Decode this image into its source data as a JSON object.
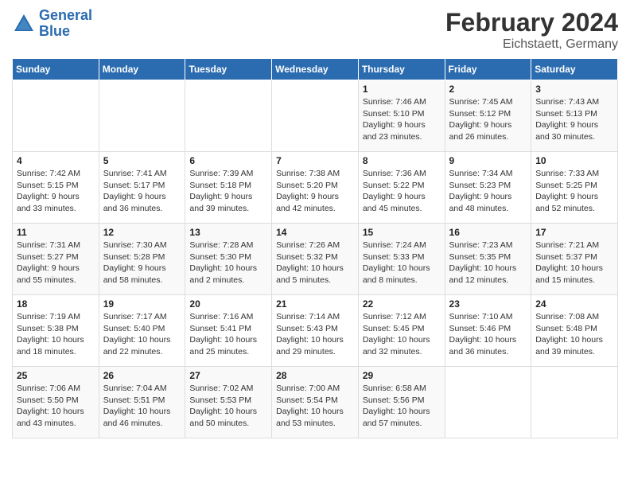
{
  "header": {
    "logo_general": "General",
    "logo_blue": "Blue",
    "month_title": "February 2024",
    "subtitle": "Eichstaett, Germany"
  },
  "days_of_week": [
    "Sunday",
    "Monday",
    "Tuesday",
    "Wednesday",
    "Thursday",
    "Friday",
    "Saturday"
  ],
  "weeks": [
    [
      {
        "day": "",
        "info": ""
      },
      {
        "day": "",
        "info": ""
      },
      {
        "day": "",
        "info": ""
      },
      {
        "day": "",
        "info": ""
      },
      {
        "day": "1",
        "info": "Sunrise: 7:46 AM\nSunset: 5:10 PM\nDaylight: 9 hours\nand 23 minutes."
      },
      {
        "day": "2",
        "info": "Sunrise: 7:45 AM\nSunset: 5:12 PM\nDaylight: 9 hours\nand 26 minutes."
      },
      {
        "day": "3",
        "info": "Sunrise: 7:43 AM\nSunset: 5:13 PM\nDaylight: 9 hours\nand 30 minutes."
      }
    ],
    [
      {
        "day": "4",
        "info": "Sunrise: 7:42 AM\nSunset: 5:15 PM\nDaylight: 9 hours\nand 33 minutes."
      },
      {
        "day": "5",
        "info": "Sunrise: 7:41 AM\nSunset: 5:17 PM\nDaylight: 9 hours\nand 36 minutes."
      },
      {
        "day": "6",
        "info": "Sunrise: 7:39 AM\nSunset: 5:18 PM\nDaylight: 9 hours\nand 39 minutes."
      },
      {
        "day": "7",
        "info": "Sunrise: 7:38 AM\nSunset: 5:20 PM\nDaylight: 9 hours\nand 42 minutes."
      },
      {
        "day": "8",
        "info": "Sunrise: 7:36 AM\nSunset: 5:22 PM\nDaylight: 9 hours\nand 45 minutes."
      },
      {
        "day": "9",
        "info": "Sunrise: 7:34 AM\nSunset: 5:23 PM\nDaylight: 9 hours\nand 48 minutes."
      },
      {
        "day": "10",
        "info": "Sunrise: 7:33 AM\nSunset: 5:25 PM\nDaylight: 9 hours\nand 52 minutes."
      }
    ],
    [
      {
        "day": "11",
        "info": "Sunrise: 7:31 AM\nSunset: 5:27 PM\nDaylight: 9 hours\nand 55 minutes."
      },
      {
        "day": "12",
        "info": "Sunrise: 7:30 AM\nSunset: 5:28 PM\nDaylight: 9 hours\nand 58 minutes."
      },
      {
        "day": "13",
        "info": "Sunrise: 7:28 AM\nSunset: 5:30 PM\nDaylight: 10 hours\nand 2 minutes."
      },
      {
        "day": "14",
        "info": "Sunrise: 7:26 AM\nSunset: 5:32 PM\nDaylight: 10 hours\nand 5 minutes."
      },
      {
        "day": "15",
        "info": "Sunrise: 7:24 AM\nSunset: 5:33 PM\nDaylight: 10 hours\nand 8 minutes."
      },
      {
        "day": "16",
        "info": "Sunrise: 7:23 AM\nSunset: 5:35 PM\nDaylight: 10 hours\nand 12 minutes."
      },
      {
        "day": "17",
        "info": "Sunrise: 7:21 AM\nSunset: 5:37 PM\nDaylight: 10 hours\nand 15 minutes."
      }
    ],
    [
      {
        "day": "18",
        "info": "Sunrise: 7:19 AM\nSunset: 5:38 PM\nDaylight: 10 hours\nand 18 minutes."
      },
      {
        "day": "19",
        "info": "Sunrise: 7:17 AM\nSunset: 5:40 PM\nDaylight: 10 hours\nand 22 minutes."
      },
      {
        "day": "20",
        "info": "Sunrise: 7:16 AM\nSunset: 5:41 PM\nDaylight: 10 hours\nand 25 minutes."
      },
      {
        "day": "21",
        "info": "Sunrise: 7:14 AM\nSunset: 5:43 PM\nDaylight: 10 hours\nand 29 minutes."
      },
      {
        "day": "22",
        "info": "Sunrise: 7:12 AM\nSunset: 5:45 PM\nDaylight: 10 hours\nand 32 minutes."
      },
      {
        "day": "23",
        "info": "Sunrise: 7:10 AM\nSunset: 5:46 PM\nDaylight: 10 hours\nand 36 minutes."
      },
      {
        "day": "24",
        "info": "Sunrise: 7:08 AM\nSunset: 5:48 PM\nDaylight: 10 hours\nand 39 minutes."
      }
    ],
    [
      {
        "day": "25",
        "info": "Sunrise: 7:06 AM\nSunset: 5:50 PM\nDaylight: 10 hours\nand 43 minutes."
      },
      {
        "day": "26",
        "info": "Sunrise: 7:04 AM\nSunset: 5:51 PM\nDaylight: 10 hours\nand 46 minutes."
      },
      {
        "day": "27",
        "info": "Sunrise: 7:02 AM\nSunset: 5:53 PM\nDaylight: 10 hours\nand 50 minutes."
      },
      {
        "day": "28",
        "info": "Sunrise: 7:00 AM\nSunset: 5:54 PM\nDaylight: 10 hours\nand 53 minutes."
      },
      {
        "day": "29",
        "info": "Sunrise: 6:58 AM\nSunset: 5:56 PM\nDaylight: 10 hours\nand 57 minutes."
      },
      {
        "day": "",
        "info": ""
      },
      {
        "day": "",
        "info": ""
      }
    ]
  ]
}
